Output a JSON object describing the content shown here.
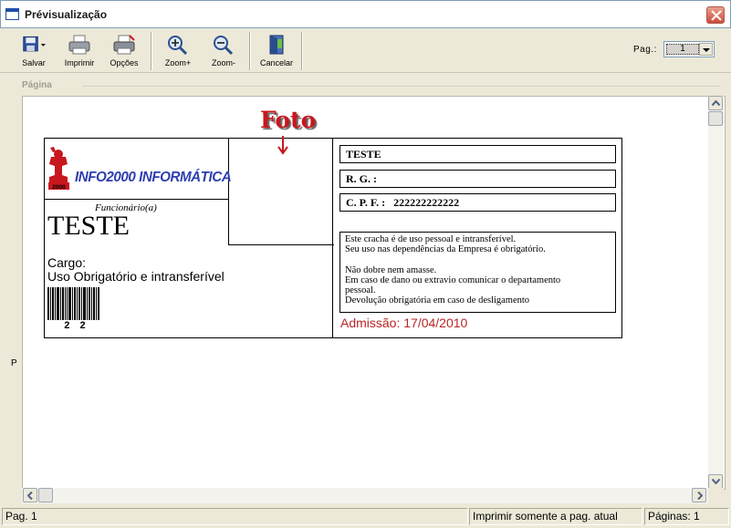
{
  "window": {
    "title": "Prévisualização"
  },
  "toolbar": {
    "buttons": [
      {
        "label": "Salvar",
        "icon": "floppy-disk-icon"
      },
      {
        "label": "Imprimir",
        "icon": "printer-icon"
      },
      {
        "label": "Opções",
        "icon": "printer-settings-icon"
      },
      {
        "label": "Zoom+",
        "icon": "zoom-in-icon"
      },
      {
        "label": "Zoom-",
        "icon": "zoom-out-icon"
      },
      {
        "label": "Cancelar",
        "icon": "exit-door-icon"
      }
    ],
    "page_label": "Pag.:",
    "page_value": "1"
  },
  "page_header": {
    "label": "Página"
  },
  "left_marker": "P",
  "badge": {
    "foto_label": "Foto",
    "company_name": "INFO2000 INFORMÁTICA",
    "logo_text": "2000",
    "funcionario_label": "Funcionário(a)",
    "employee_name": "TESTE",
    "cargo_label": "Cargo:",
    "cargo_value": "Uso Obrigatório e intransferível",
    "barcode_number": "2 2",
    "name_field": "TESTE",
    "rg_field": "R. G. :",
    "cpf_field": "C. P. F. :   222222222222",
    "notice_lines": [
      "Este cracha é de uso pessoal e intransferível.",
      "Seu uso nas dependências da Empresa é obrigatório.",
      "",
      "Não dobre nem amasse.",
      "Em caso de dano ou extravio comunicar o departamento",
      "pessoal.",
      "Devolução obrigatória em caso de desligamento"
    ],
    "admissao": "Admissão: 17/04/2010"
  },
  "statusbar": {
    "page": "Pag. 1",
    "print_option": "Imprimir somente a pag. atual",
    "pages": "Páginas: 1"
  },
  "colors": {
    "brand_red": "#c8171e",
    "brand_blue": "#2f3fb0",
    "admissao_red": "#b82524"
  }
}
